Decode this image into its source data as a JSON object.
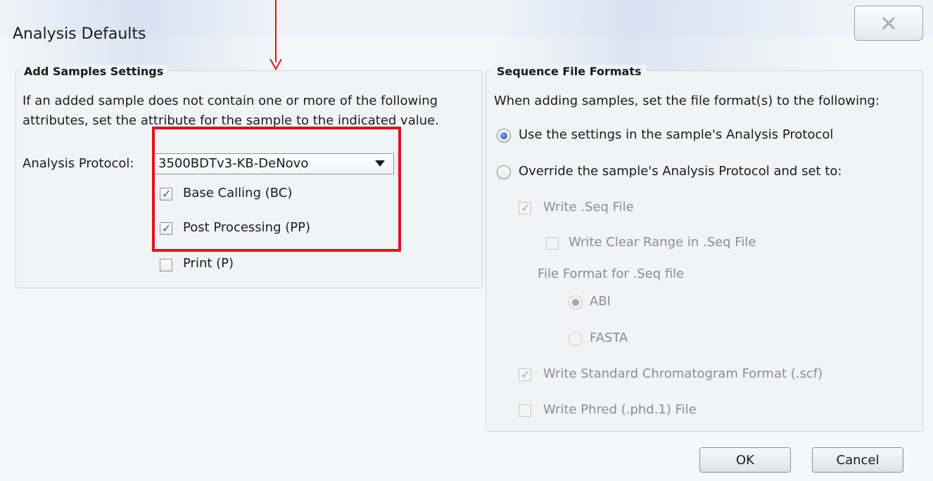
{
  "window": {
    "title": "Analysis Defaults"
  },
  "add_samples": {
    "legend": "Add Samples Settings",
    "desc_line1": "If an added sample does not contain one or more of the following",
    "desc_line2": "attributes, set the attribute for the sample to the indicated value.",
    "protocol_label": "Analysis Protocol:",
    "protocol_value": "3500BDTv3-KB-DeNovo",
    "checkboxes": [
      {
        "label": "Base Calling (BC)",
        "checked": true
      },
      {
        "label": "Post Processing (PP)",
        "checked": true
      },
      {
        "label": "Print (P)",
        "checked": false
      }
    ]
  },
  "seq_formats": {
    "legend": "Sequence File Formats",
    "desc": "When adding samples, set the file format(s) to the following:",
    "radio_use": "Use the settings in the sample's Analysis Protocol",
    "radio_override": "Override the sample's Analysis Protocol and set to:",
    "write_seq": "Write .Seq File",
    "write_clear_range": "Write Clear Range in .Seq File",
    "file_format_label": "File Format for .Seq file",
    "abi": "ABI",
    "fasta": "FASTA",
    "write_scf": "Write Standard Chromatogram Format (.scf)",
    "write_phred": "Write Phred (.phd.1) File"
  },
  "buttons": {
    "ok": "OK",
    "cancel": "Cancel"
  },
  "colors": {
    "highlight": "#e2141c",
    "radio_selected": "#1c4ea3"
  },
  "icons": {
    "close": "close-icon",
    "dropdown": "chevron-down-icon"
  }
}
